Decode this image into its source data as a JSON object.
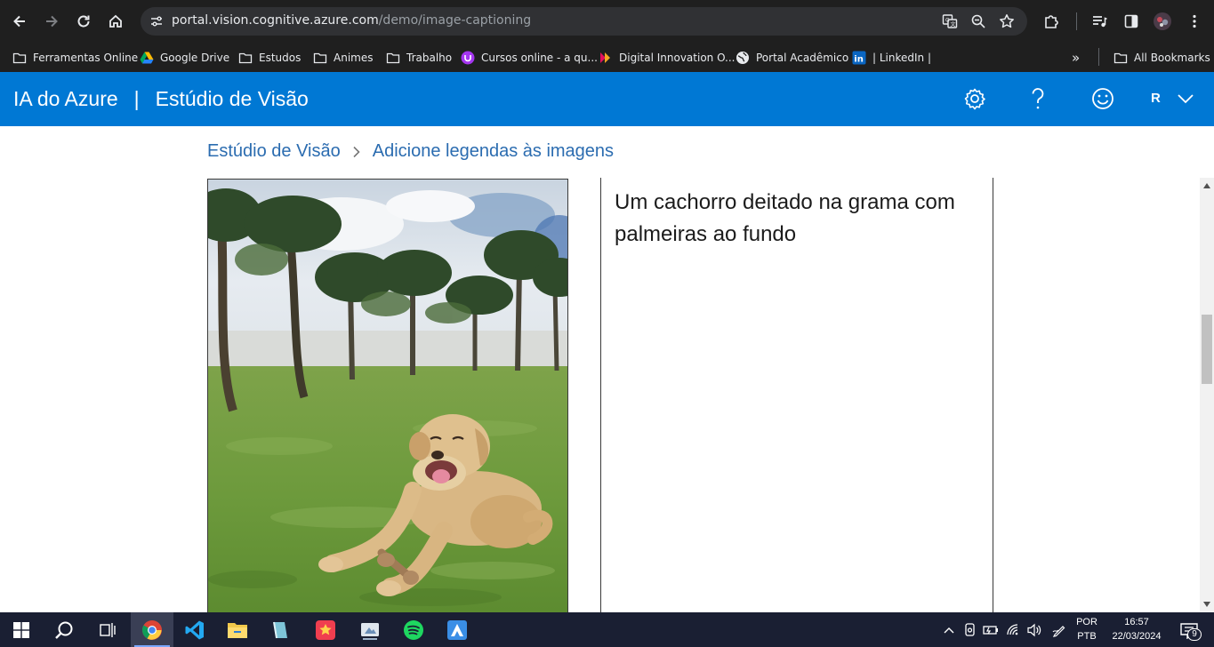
{
  "browser": {
    "url_host": "portal.vision.cognitive.azure.com",
    "url_path": "/demo/image-captioning",
    "bookmarks": [
      {
        "label": "Ferramentas Online",
        "icon": "folder-icon"
      },
      {
        "label": "Google Drive",
        "icon": "google-drive-icon"
      },
      {
        "label": "Estudos",
        "icon": "folder-icon"
      },
      {
        "label": "Animes",
        "icon": "folder-icon"
      },
      {
        "label": "Trabalho",
        "icon": "folder-icon"
      },
      {
        "label": "Cursos online - a qu...",
        "icon": "udemy-icon"
      },
      {
        "label": "Digital Innovation O...",
        "icon": "dio-icon"
      },
      {
        "label": "Portal Acadêmico",
        "icon": "globe-icon"
      },
      {
        "label": "| LinkedIn |",
        "icon": "linkedin-icon"
      }
    ],
    "overflow_label": "»",
    "all_bookmarks_label": "All Bookmarks"
  },
  "app": {
    "brand": "IA do Azure",
    "separator": "|",
    "product": "Estúdio de Visão",
    "user_initial": "R",
    "accent_color": "#0078d4"
  },
  "breadcrumb": {
    "root": "Estúdio de Visão",
    "current": "Adicione legendas às imagens"
  },
  "result": {
    "caption": "Um cachorro deitado na grama com palmeiras ao fundo"
  },
  "taskbar": {
    "lang_top": "POR",
    "lang_bottom": "PTB",
    "time": "16:57",
    "date": "22/03/2024",
    "notification_count": "9"
  }
}
